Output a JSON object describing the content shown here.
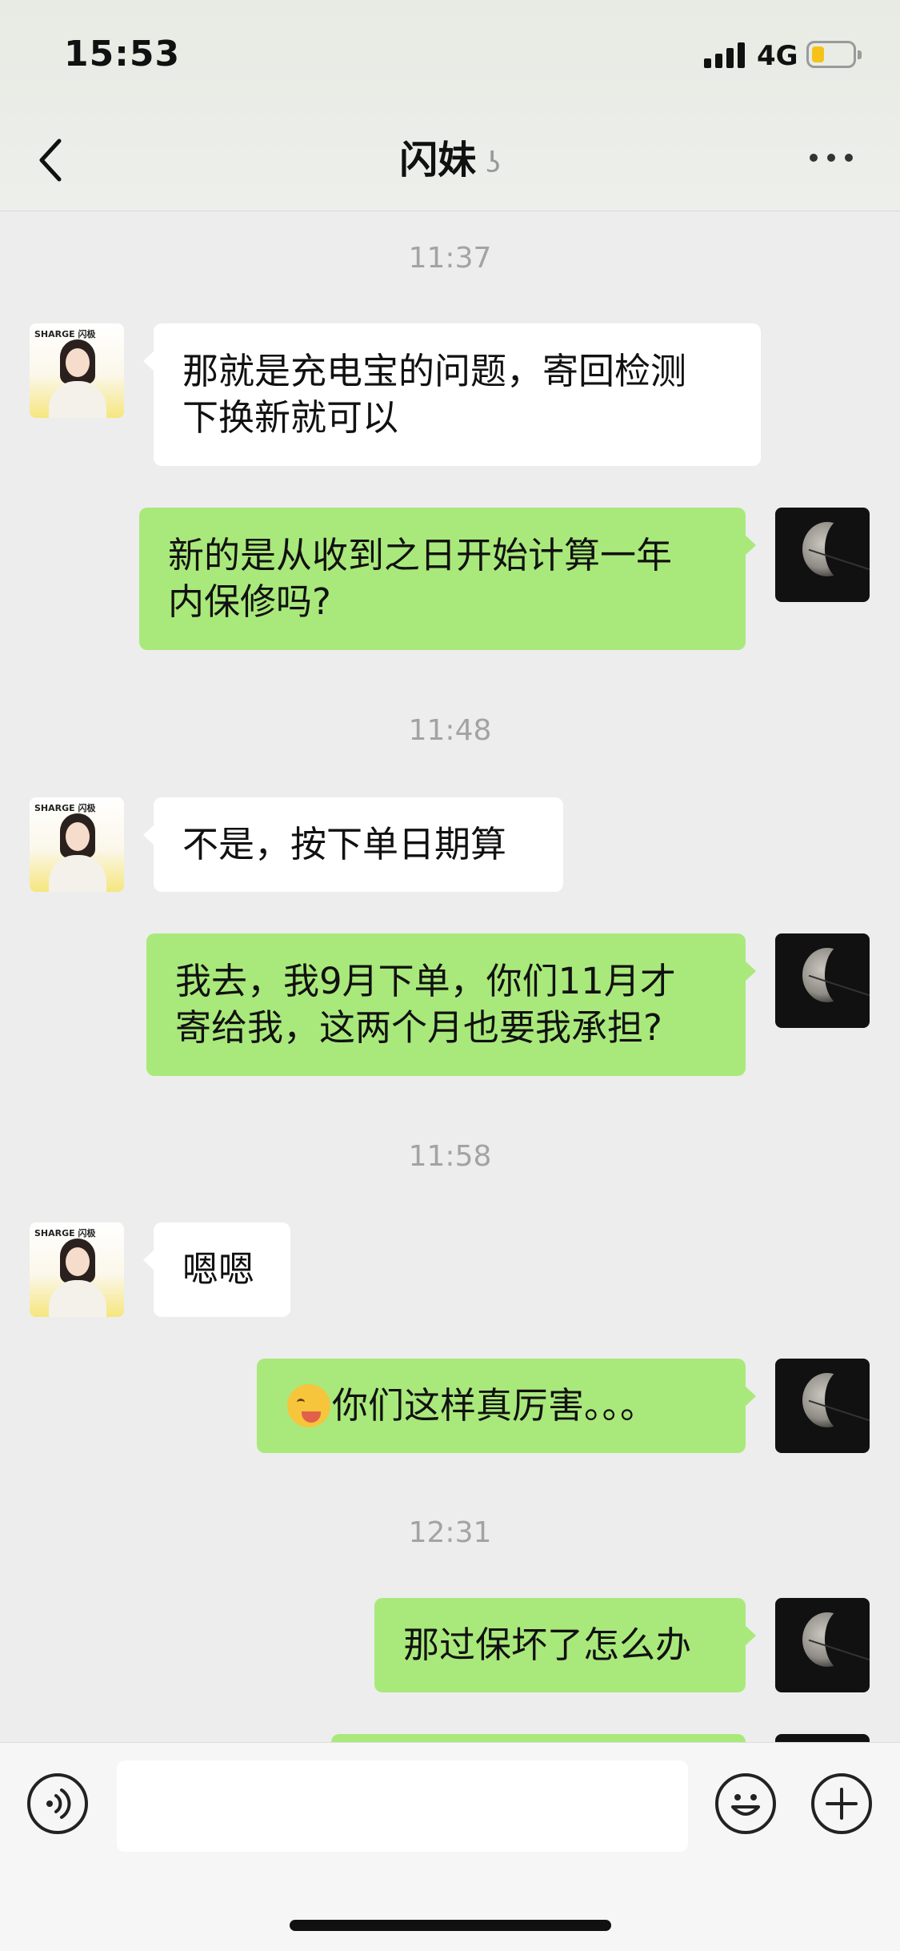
{
  "status": {
    "time": "15:53",
    "network": "4G",
    "battery_level": 0.3
  },
  "nav": {
    "title": "闪妹",
    "title_icon": "ear-icon",
    "back_icon": "chevron-left-icon",
    "more_icon": "ellipsis-icon"
  },
  "avatars": {
    "contact_brand": "SHARGE 闪极"
  },
  "messages": {
    "ts1": "11:37",
    "m1": "那就是充电宝的问题，寄回检测\n下换新就可以",
    "m2": "新的是从收到之日开始计算一年\n内保修吗?",
    "ts2": "11:48",
    "m3": "不是，按下单日期算",
    "m4": "我去，我9月下单，你们11月才\n寄给我，这两个月也要我承担?",
    "ts3": "11:58",
    "m5": "嗯嗯",
    "m6_emoji": "thinking-face-emoji",
    "m6": "你们这样真厉害。。。",
    "ts4": "12:31",
    "m7": "那过保坏了怎么办"
  },
  "input_bar": {
    "voice_icon": "voice-icon",
    "emoji_icon": "smiley-icon",
    "plus_icon": "plus-icon",
    "text_value": ""
  },
  "colors": {
    "bg": "#ededed",
    "own_bubble": "#a9e97b",
    "other_bubble": "#ffffff"
  }
}
